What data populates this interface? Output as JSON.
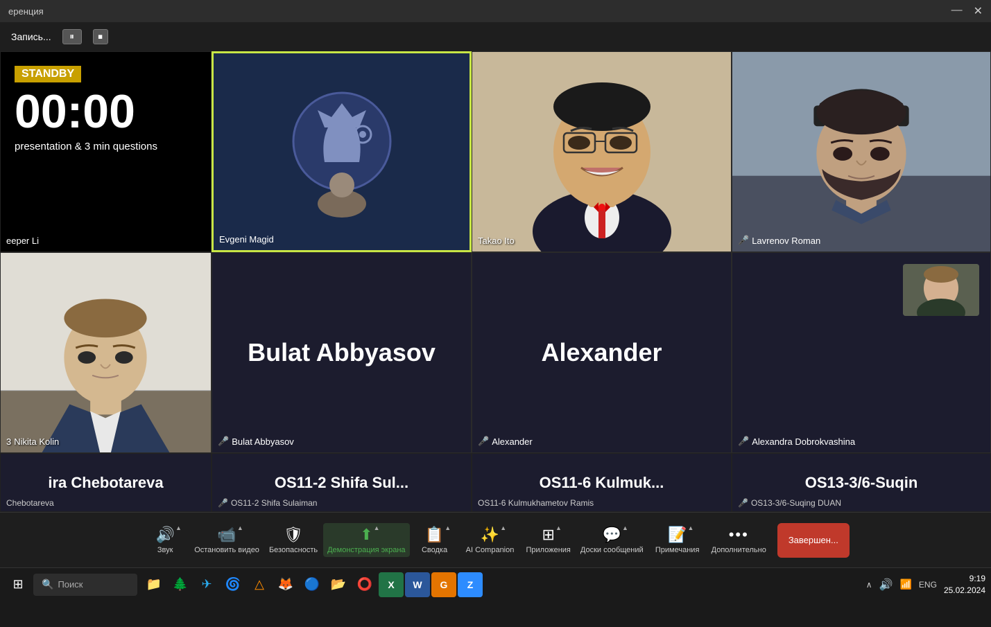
{
  "titlebar": {
    "title": "еренция",
    "controls": [
      "—",
      "□",
      "✕"
    ]
  },
  "topbar": {
    "recording_label": "Запись...",
    "pause_icon": "⏸",
    "stop_icon": "⏹"
  },
  "grid": {
    "rows": [
      [
        {
          "type": "standby",
          "standby_label": "STANDBY",
          "time": "00:00",
          "description": "presentation & 3 min questions",
          "participant": "eeper Li"
        },
        {
          "type": "evgeni",
          "participant": "Evgeni Magid",
          "muted": false
        },
        {
          "type": "face",
          "bg": "beige",
          "participant": "Takao Ito",
          "muted": false
        },
        {
          "type": "face",
          "bg": "dark",
          "participant": "Lavrenov Roman",
          "muted": true
        }
      ],
      [
        {
          "type": "face",
          "bg": "light",
          "participant": "Nikita Kolin",
          "label_prefix": "3",
          "muted": false
        },
        {
          "type": "darkname",
          "big_name": "Bulat Abbyasov",
          "participant": "Bulat Abbyasov",
          "muted": true
        },
        {
          "type": "darkname",
          "big_name": "Alexander",
          "participant": "Alexander",
          "muted": true
        },
        {
          "type": "darkname_with_thumb",
          "big_name": "",
          "participant": "Alexandra Dobrokvashina",
          "muted": true,
          "has_thumb": true
        }
      ]
    ],
    "bottom_row": [
      {
        "type": "darkname",
        "big_name": "ira Chebotareva",
        "participant": "Chebotareva",
        "muted": false
      },
      {
        "type": "darkname",
        "big_name": "OS11-2  Shifa  Sul...",
        "participant": "OS11-2 Shifa Sulaiman",
        "muted": true
      },
      {
        "type": "darkname",
        "big_name": "OS11-6  Kulmuk...",
        "participant": "OS11-6 Kulmukhametov Ramis",
        "muted": false
      },
      {
        "type": "darkname",
        "big_name": "OS13-3/6-Suqin",
        "participant": "OS13-3/6-Suqing DUAN",
        "muted": true
      }
    ]
  },
  "toolbar": {
    "items": [
      {
        "icon": "🔊",
        "label": "Звук",
        "has_caret": true
      },
      {
        "icon": "📹",
        "label": "Остановить видео",
        "has_caret": true
      },
      {
        "icon": "🛡",
        "label": "Безопасность",
        "has_caret": false
      },
      {
        "icon": "⬆",
        "label": "Демонстрация экрана",
        "has_caret": true,
        "green": true
      },
      {
        "icon": "📋",
        "label": "Сводка",
        "has_caret": true
      },
      {
        "icon": "✨",
        "label": "AI Companion",
        "has_caret": true
      },
      {
        "icon": "⊞",
        "label": "Приложения",
        "has_caret": true
      },
      {
        "icon": "💬",
        "label": "Доски сообщений",
        "has_caret": true
      },
      {
        "icon": "📝",
        "label": "Примечания",
        "has_caret": true
      },
      {
        "icon": "•••",
        "label": "Дополнительно",
        "has_caret": false
      }
    ],
    "end_button": "Завершен..."
  },
  "taskbar": {
    "search_placeholder": "Поиск",
    "time": "9:19",
    "date": "25.02.2024",
    "sys_icons": [
      "∧",
      "🔊",
      "📶",
      "ENG"
    ],
    "app_icons": [
      "⊞",
      "🌲",
      "📁",
      "🟣",
      "📧",
      "🔵",
      "🟠",
      "🔴",
      "🟡",
      "🗂",
      "🔵",
      "📄",
      "🟢",
      "🔵",
      "Z"
    ]
  },
  "colors": {
    "accent_green": "#c8e645",
    "standby_yellow": "#c8a000",
    "toolbar_bg": "#1e1e1e",
    "grid_bg": "#1c1c2e",
    "end_btn": "#c0392b",
    "zoom_blue": "#2d8cff"
  }
}
